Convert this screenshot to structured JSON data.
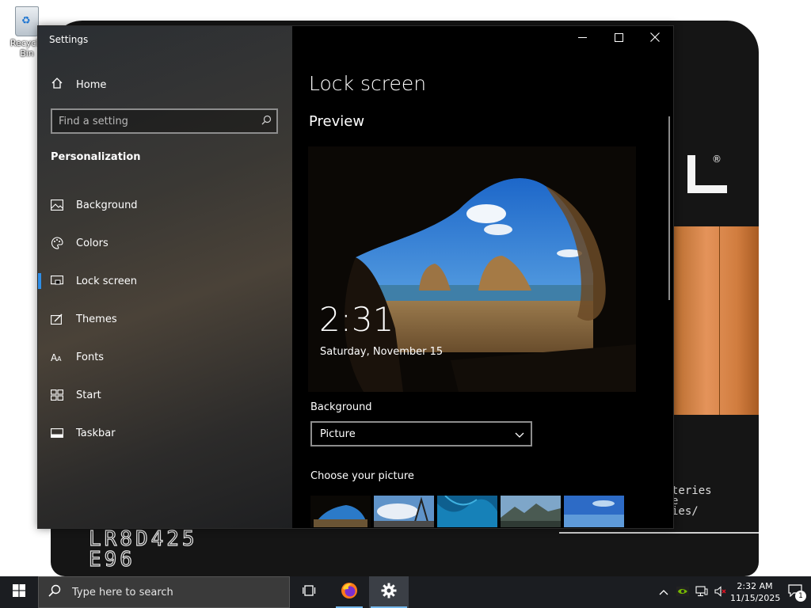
{
  "desktop": {
    "recycle_bin_label": "Recycle Bin",
    "battery_model_line1": "LR8D425",
    "battery_model_line2": "E96",
    "battery_text_line1": "teries",
    "battery_text_line2": "e",
    "battery_text_line3": "ies/",
    "battery_reg_mark": "®"
  },
  "window": {
    "app_title": "Settings",
    "minimize_icon": "minimize-icon",
    "maximize_icon": "maximize-icon",
    "close_icon": "close-icon"
  },
  "nav": {
    "home_label": "Home",
    "search_placeholder": "Find a setting",
    "section_title": "Personalization",
    "items": [
      {
        "label": "Background",
        "icon": "picture-icon",
        "selected": false
      },
      {
        "label": "Colors",
        "icon": "palette-icon",
        "selected": false
      },
      {
        "label": "Lock screen",
        "icon": "lock-screen-icon",
        "selected": true
      },
      {
        "label": "Themes",
        "icon": "themes-icon",
        "selected": false
      },
      {
        "label": "Fonts",
        "icon": "fonts-icon",
        "selected": false
      },
      {
        "label": "Start",
        "icon": "start-icon",
        "selected": false
      },
      {
        "label": "Taskbar",
        "icon": "taskbar-icon",
        "selected": false
      }
    ]
  },
  "content": {
    "page_title": "Lock screen",
    "preview_title": "Preview",
    "preview_time": "2:31",
    "preview_date": "Saturday, November 15",
    "background_label": "Background",
    "background_value": "Picture",
    "choose_picture_label": "Choose your picture"
  },
  "taskbar": {
    "search_placeholder": "Type here to search",
    "clock_time": "2:32 AM",
    "clock_date": "11/15/2025",
    "notification_count": "1"
  },
  "colors": {
    "accent": "#2f8fe8",
    "taskbar_bg": "#1b1d21",
    "content_bg": "#000000"
  }
}
